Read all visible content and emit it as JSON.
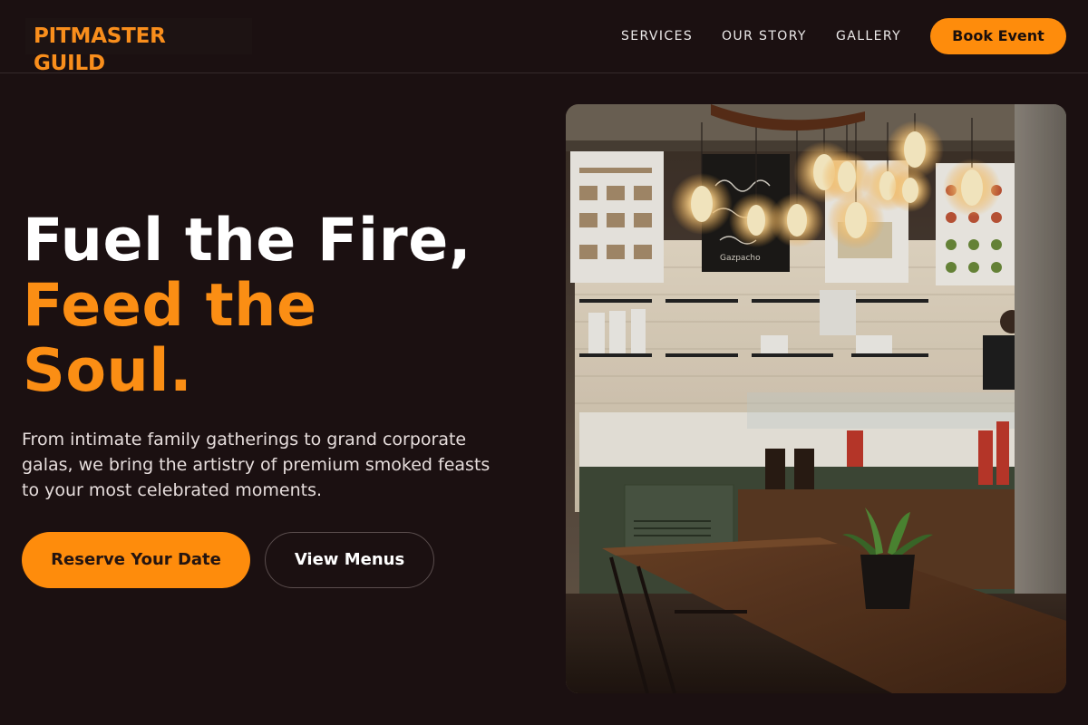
{
  "header": {
    "brand": "PITMASTER GUILD",
    "nav": [
      {
        "label": "SERVICES"
      },
      {
        "label": "OUR STORY"
      },
      {
        "label": "GALLERY"
      }
    ],
    "cta_label": "Book Event"
  },
  "hero": {
    "title_line1": "Fuel the Fire,",
    "title_line2": "Feed the",
    "title_line3": "Soul.",
    "description": "From intimate family gatherings to grand corporate galas, we bring the artistry of premium smoked feasts to your most celebrated moments.",
    "primary_button": "Reserve Your Date",
    "secondary_button": "View Menus",
    "image_alt": "Cozy café interior with hanging Edison bulbs, menu boards and a wooden table",
    "menu_board_text": "Gazpacho"
  },
  "colors": {
    "background": "#1b1011",
    "accent": "#fb8e14",
    "text": "#ffffff",
    "muted_text": "#e6dddc"
  }
}
